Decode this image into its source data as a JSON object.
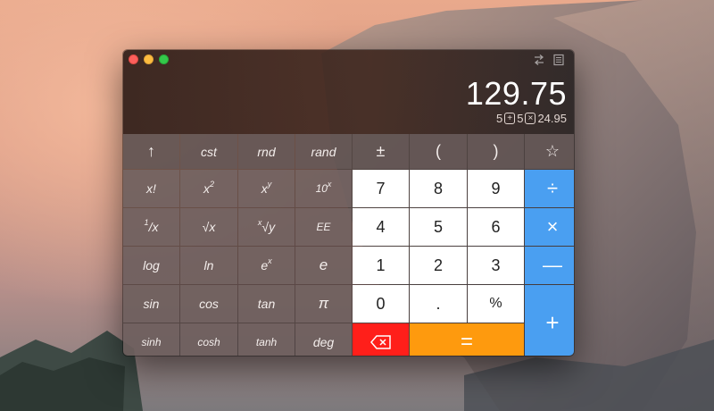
{
  "window": {
    "result": "129.75",
    "expression": {
      "a": "5",
      "op1": "+",
      "b": "5",
      "op2": "×",
      "c": "24.95"
    },
    "icons": [
      "swap-icon",
      "paper-tape-icon"
    ]
  },
  "keys": {
    "row1": {
      "up": "↑",
      "cst": "cst",
      "rnd": "rnd",
      "rand": "rand",
      "pm": "±",
      "lparen": "(",
      "rparen": ")",
      "star": "☆"
    },
    "row2": {
      "fact": "x!",
      "sq_base": "x",
      "sq_exp": "2",
      "pow_base": "x",
      "pow_exp": "y",
      "ten_base": "10",
      "ten_exp": "x",
      "d7": "7",
      "d8": "8",
      "d9": "9",
      "div": "÷"
    },
    "row3": {
      "inv_num": "1",
      "inv_den": "/x",
      "sqrt": "√x",
      "root_idx": "x",
      "root": "√y",
      "ee": "EE",
      "d4": "4",
      "d5": "5",
      "d6": "6",
      "mul": "×"
    },
    "row4": {
      "log": "log",
      "ln": "ln",
      "ex_base": "e",
      "ex_exp": "x",
      "e": "e",
      "d1": "1",
      "d2": "2",
      "d3": "3",
      "minus": "—"
    },
    "row5": {
      "sin": "sin",
      "cos": "cos",
      "tan": "tan",
      "pi": "π",
      "d0": "0",
      "dot": ".",
      "pct": "%",
      "plus": "+"
    },
    "row6": {
      "sinh": "sinh",
      "cosh": "cosh",
      "tanh": "tanh",
      "deg": "deg",
      "eq": "="
    }
  }
}
